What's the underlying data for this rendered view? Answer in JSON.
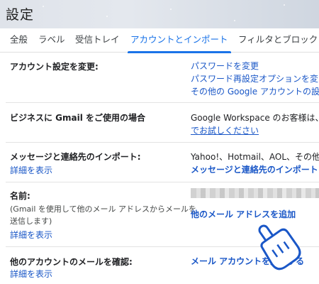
{
  "page": {
    "title": "設定"
  },
  "tabs": [
    {
      "label": "全般"
    },
    {
      "label": "ラベル"
    },
    {
      "label": "受信トレイ"
    },
    {
      "label": "アカウントとインポート",
      "active": true
    },
    {
      "label": "フィルタとブロック"
    }
  ],
  "settings": {
    "change_account": {
      "label": "アカウント設定を変更:",
      "links": [
        "パスワードを変更",
        "パスワード再設定オプションを変",
        "その他の Google アカウントの設"
      ]
    },
    "gmail_business": {
      "label": "ビジネスに Gmail をご使用の場合",
      "text": "Google Workspace のお客様は、",
      "link": "でお試しください"
    },
    "import": {
      "label": "メッセージと連絡先のインポート:",
      "detail": "詳細を表示",
      "text": "Yahoo!、Hotmail、AOL、その他",
      "link": "メッセージと連絡先のインポート"
    },
    "name": {
      "label": "名前:",
      "note_line1": "(Gmail を使用して他のメール アドレスからメールを",
      "note_line2": "送信します)",
      "detail": "詳細を表示",
      "link": "他のメール アドレスを追加"
    },
    "check_mail": {
      "label": "他のアカウントのメールを確認:",
      "detail": "詳細を表示",
      "link": "メール アカウントを追加する"
    }
  },
  "colors": {
    "accent": "#1a73e8",
    "link": "#1a57c7"
  },
  "icons": {
    "pointer": "hand-pointer-icon"
  }
}
